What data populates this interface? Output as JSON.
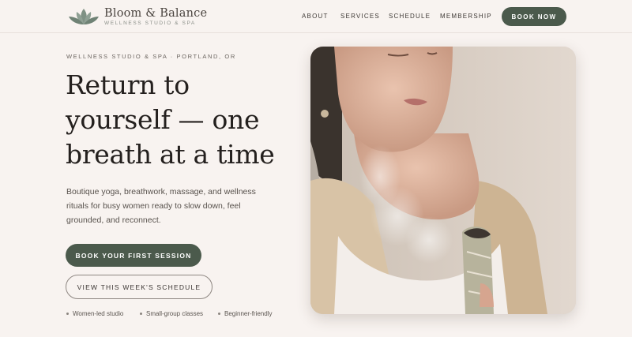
{
  "brand": {
    "name": "Bloom & Balance",
    "tagline": "WELLNESS STUDIO & SPA",
    "logo_icon": "lotus-icon"
  },
  "nav": {
    "links": [
      "ABOUT",
      "SERVICES",
      "SCHEDULE",
      "MEMBERSHIP"
    ],
    "cta": "BOOK NOW"
  },
  "hero": {
    "eyebrow": "WELLNESS STUDIO & SPA · PORTLAND, OR",
    "headline_lines": [
      "Return to",
      "yourself — one",
      "breath at a time"
    ],
    "lede": "Boutique yoga, breathwork, massage, and wellness rituals for busy women ready to slow down, feel grounded, and reconnect.",
    "primary_cta": "BOOK YOUR FIRST SESSION",
    "secondary_cta": "VIEW THIS WEEK'S SCHEDULE",
    "badges": [
      "Women-led studio",
      "Small-group classes",
      "Beginner-friendly"
    ]
  },
  "colors": {
    "background": "#f8f3f0",
    "accent": "#4b5a4c",
    "text": "#24201e"
  }
}
